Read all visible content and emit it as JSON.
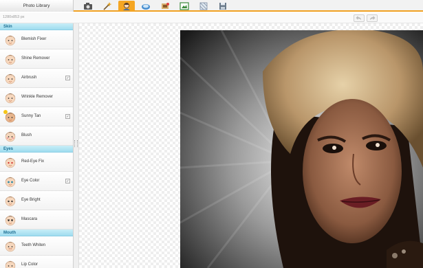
{
  "toolbar": {
    "library_label": "Photo Library",
    "tools": [
      "camera-icon",
      "magic-wand-icon",
      "face-retouch-icon",
      "frame-icon",
      "effects-icon",
      "image-overlay-icon",
      "texture-icon",
      "save-icon"
    ],
    "active_tool": "face-retouch-icon",
    "accent_color": "#f0a020"
  },
  "info": {
    "dimensions": "1280x853 px",
    "undo_icon": "undo-icon",
    "redo_icon": "redo-icon"
  },
  "sidebar": {
    "section_color": "#9fdcef",
    "sections": [
      {
        "title": "Skin",
        "items": [
          {
            "label": "Blemish Fixer",
            "check": false
          },
          {
            "label": "Shine Remover",
            "check": false
          },
          {
            "label": "Airbrush",
            "check": true
          },
          {
            "label": "Wrinkle Remover",
            "check": false
          },
          {
            "label": "Sunny Tan",
            "check": true
          },
          {
            "label": "Blush",
            "check": false
          }
        ]
      },
      {
        "title": "Eyes",
        "items": [
          {
            "label": "Red-Eye Fix",
            "check": false
          },
          {
            "label": "Eye Color",
            "check": true
          },
          {
            "label": "Eye Bright",
            "check": false
          },
          {
            "label": "Mascara",
            "check": false
          }
        ]
      },
      {
        "title": "Mouth",
        "items": [
          {
            "label": "Teeth Whiten",
            "check": false
          },
          {
            "label": "Lip Color",
            "check": false
          }
        ]
      }
    ]
  }
}
